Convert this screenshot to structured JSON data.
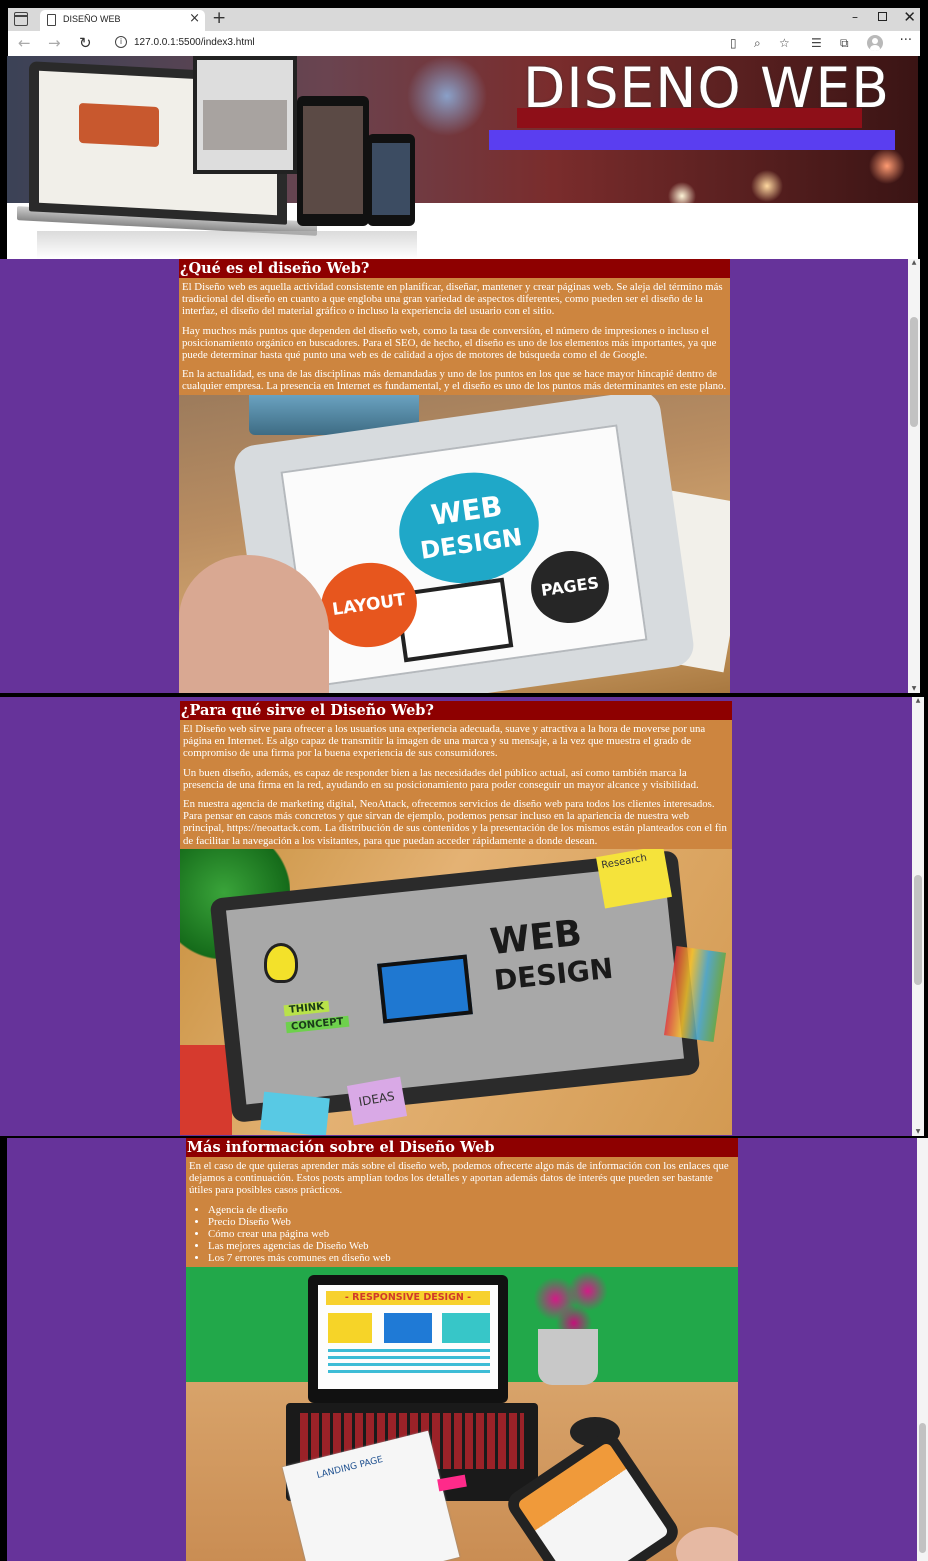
{
  "browser": {
    "tab_title": "DISEÑO WEB",
    "url": "127.0.0.1:5500/index3.html",
    "tab_close": "×",
    "new_tab": "+",
    "minimize": "–",
    "close": "✕",
    "more": "···",
    "back": "←",
    "forward": "→",
    "reload": "↻"
  },
  "header": {
    "title": "DISENO WEB",
    "colors": {
      "bar_red": "#8e0f18",
      "bar_blue": "#5a3ef0"
    }
  },
  "sections": [
    {
      "heading": "¿Qué es el diseño Web?",
      "paragraphs": [
        "El Diseño web es aquella actividad consistente en planificar, diseñar, mantener y crear páginas web. Se aleja del término más tradicional del diseño en cuanto a que engloba una gran variedad de aspectos diferentes, como pueden ser el diseño de la interfaz, el diseño del material gráfico o incluso la experiencia del usuario con el sitio.",
        "Hay muchos más puntos que dependen del diseño web, como la tasa de conversión, el número de impresiones o incluso el posicionamiento orgánico en buscadores. Para el SEO, de hecho, el diseño es uno de los elementos más importantes, ya que puede determinar hasta qué punto una web es de calidad a ojos de motores de búsqueda como el de Google.",
        "En la actualidad, es una de las disciplinas más demandadas y uno de los puntos en los que se hace mayor hincapié dentro de cualquier empresa. La presencia en Internet es fundamental, y el diseño es uno de los puntos más determinantes en este plano."
      ],
      "image": {
        "text_web": "WEB",
        "text_design": "DESIGN",
        "text_layout": "LAYOUT",
        "text_pages": "PAGES"
      }
    },
    {
      "heading": "¿Para qué sirve el Diseño Web?",
      "paragraphs": [
        "El Diseño web sirve para ofrecer a los usuarios una experiencia adecuada, suave y atractiva a la hora de moverse por una página en Internet. Es algo capaz de transmitir la imagen de una marca y su mensaje, a la vez que muestra el grado de compromiso de una firma por la buena experiencia de sus consumidores.",
        "Un buen diseño, además, es capaz de responder bien a las necesidades del público actual, así como también marca la presencia de una firma en la red, ayudando en su posicionamiento para poder conseguir un mayor alcance y visibilidad.",
        "En nuestra agencia de marketing digital, NeoAttack, ofrecemos servicios de diseño web para todos los clientes interesados. Para pensar en casos más concretos y que sirvan de ejemplo, podemos pensar incluso en la apariencia de nuestra web principal, https://neoattack.com. La distribución de sus contenidos y la presentación de los mismos están planteados con el fin de facilitar la navegación a los visitantes, para que puedan acceder rápidamente a donde desean."
      ],
      "image": {
        "text_web": "WEB",
        "text_design": "DESIGN",
        "text_think": "THINK",
        "text_concept": "CONCEPT",
        "text_research": "Research",
        "text_ideas": "IDEAS"
      }
    },
    {
      "heading": "Más información sobre el Diseño Web",
      "paragraphs": [
        "En el caso de que quieras aprender más sobre el diseño web, podemos ofrecerte algo más de información con los enlaces que dejamos a continuación. Estos posts amplían todos los detalles y aportan además datos de interés que pueden ser bastante útiles para posibles casos prácticos."
      ],
      "links": [
        "Agencia de diseño",
        "Precio Diseño Web",
        "Cómo crear una página web",
        "Las mejores agencias de Diseño Web",
        "Los 7 errores más comunes en diseño web"
      ],
      "image": {
        "text_responsive": "- RESPONSIVE DESIGN -",
        "text_landing": "LANDING PAGE"
      }
    }
  ],
  "colors": {
    "page_bg": "#66339a",
    "heading_bg": "#8e0000",
    "body_bg": "#cd853f",
    "text": "#ffffff"
  }
}
